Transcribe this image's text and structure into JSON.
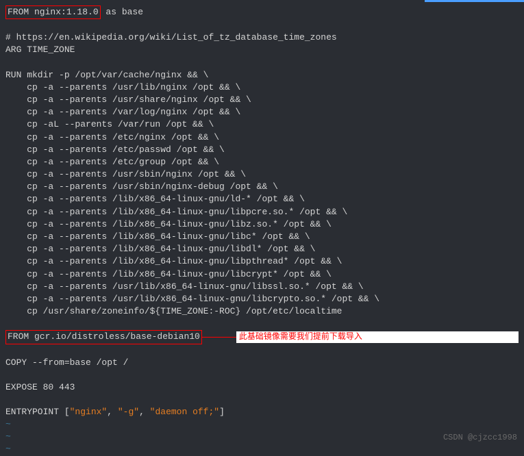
{
  "editor": {
    "highlight1_text": "FROM nginx:1.18.0",
    "after_highlight1": " as base",
    "comment": "# https://en.wikipedia.org/wiki/List_of_tz_database_time_zones",
    "arg_line": "ARG TIME_ZONE",
    "run_lines": [
      "RUN mkdir -p /opt/var/cache/nginx && \\",
      "    cp -a --parents /usr/lib/nginx /opt && \\",
      "    cp -a --parents /usr/share/nginx /opt && \\",
      "    cp -a --parents /var/log/nginx /opt && \\",
      "    cp -aL --parents /var/run /opt && \\",
      "    cp -a --parents /etc/nginx /opt && \\",
      "    cp -a --parents /etc/passwd /opt && \\",
      "    cp -a --parents /etc/group /opt && \\",
      "    cp -a --parents /usr/sbin/nginx /opt && \\",
      "    cp -a --parents /usr/sbin/nginx-debug /opt && \\",
      "    cp -a --parents /lib/x86_64-linux-gnu/ld-* /opt && \\",
      "    cp -a --parents /lib/x86_64-linux-gnu/libpcre.so.* /opt && \\",
      "    cp -a --parents /lib/x86_64-linux-gnu/libz.so.* /opt && \\",
      "    cp -a --parents /lib/x86_64-linux-gnu/libc* /opt && \\",
      "    cp -a --parents /lib/x86_64-linux-gnu/libdl* /opt && \\",
      "    cp -a --parents /lib/x86_64-linux-gnu/libpthread* /opt && \\",
      "    cp -a --parents /lib/x86_64-linux-gnu/libcrypt* /opt && \\",
      "    cp -a --parents /usr/lib/x86_64-linux-gnu/libssl.so.* /opt && \\",
      "    cp -a --parents /usr/lib/x86_64-linux-gnu/libcrypto.so.* /opt && \\",
      "    cp /usr/share/zoneinfo/${TIME_ZONE:-ROC} /opt/etc/localtime"
    ],
    "highlight2_text": "FROM gcr.io/distroless/base-debian10",
    "annotation": "此基础镜像需要我们提前下载导入",
    "copy_line": "COPY --from=base /opt /",
    "expose_line": "EXPOSE 80 443",
    "entrypoint_prefix": "ENTRYPOINT [",
    "entrypoint_str1": "\"nginx\"",
    "entrypoint_sep1": ", ",
    "entrypoint_str2": "\"-g\"",
    "entrypoint_sep2": ", ",
    "entrypoint_str3": "\"daemon off;\"",
    "entrypoint_suffix": "]",
    "tilde": "~"
  },
  "watermark": "CSDN @cjzcc1998"
}
